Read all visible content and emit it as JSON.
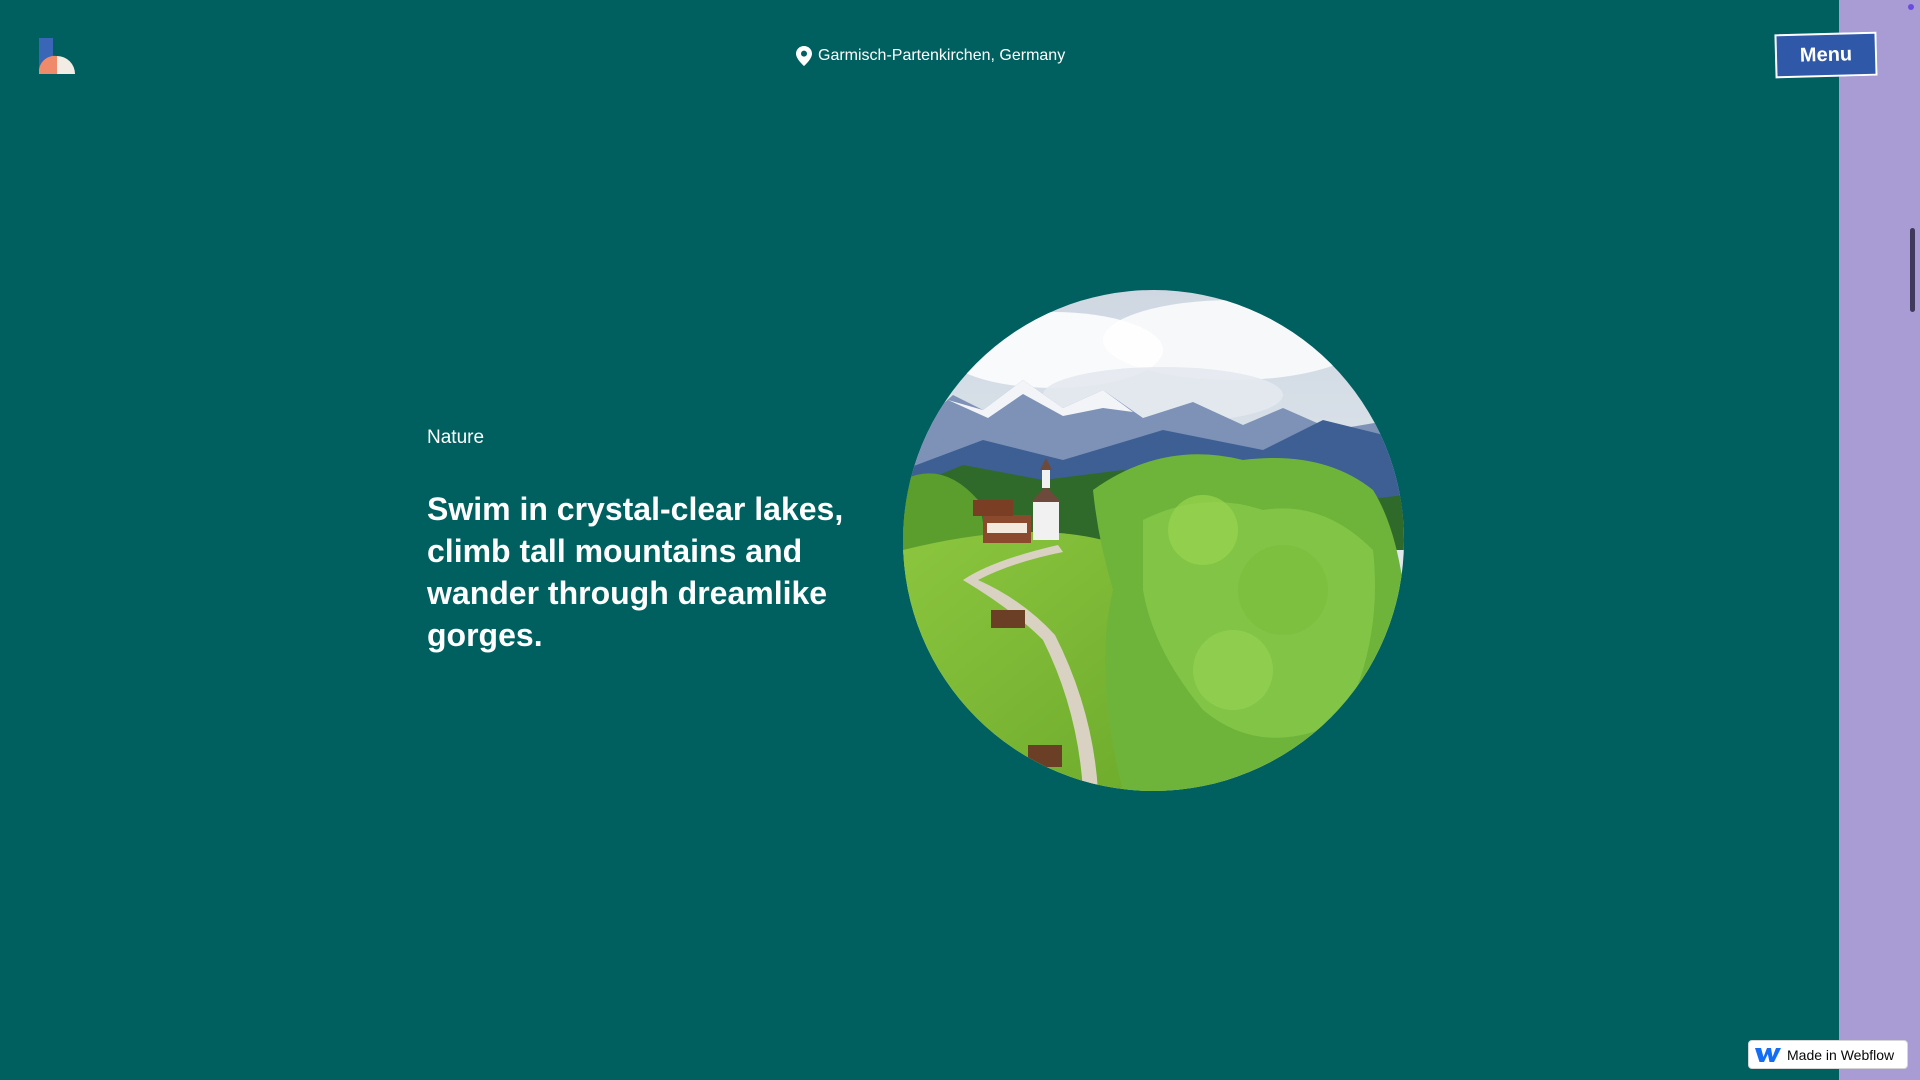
{
  "header": {
    "location": "Garmisch-Partenkirchen, Germany",
    "menu_label": "Menu"
  },
  "icons": {
    "logo": "site-logo-icon",
    "location": "map-pin-icon",
    "webflow": "webflow-logo-icon"
  },
  "main": {
    "category": "Nature",
    "headline": "Swim in crystal-clear lakes, climb tall mountains and wander through dreamlike gorges."
  },
  "badge": {
    "label": "Made in Webflow"
  },
  "colors": {
    "background": "#006060",
    "side_panel": "#a99bd3",
    "menu_button": "#2f58a8",
    "text": "#ffffff"
  }
}
